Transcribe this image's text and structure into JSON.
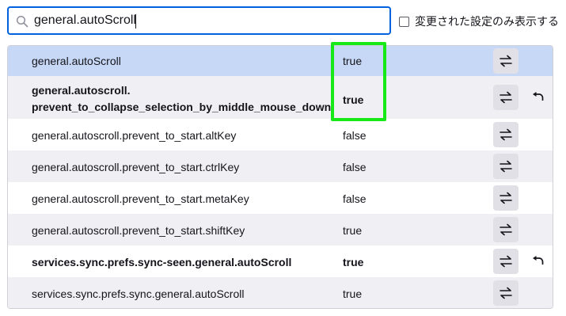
{
  "search": {
    "value": "general.autoScroll",
    "icon": "search-icon"
  },
  "filter": {
    "label": "変更された設定のみ表示する",
    "checked": false
  },
  "prefs": [
    {
      "name": "general.autoScroll",
      "value": "true",
      "modified": false,
      "selected": true
    },
    {
      "name_line1": "general.autoscroll.",
      "name_line2": "prevent_to_collapse_selection_by_middle_mouse_down",
      "value": "true",
      "modified": true,
      "multiline": true
    },
    {
      "name": "general.autoscroll.prevent_to_start.altKey",
      "value": "false",
      "modified": false
    },
    {
      "name": "general.autoscroll.prevent_to_start.ctrlKey",
      "value": "false",
      "modified": false
    },
    {
      "name": "general.autoscroll.prevent_to_start.metaKey",
      "value": "false",
      "modified": false
    },
    {
      "name": "general.autoscroll.prevent_to_start.shiftKey",
      "value": "true",
      "modified": false
    },
    {
      "name": "services.sync.prefs.sync-seen.general.autoScroll",
      "value": "true",
      "modified": true
    },
    {
      "name": "services.sync.prefs.sync.general.autoScroll",
      "value": "true",
      "modified": false
    }
  ],
  "colors": {
    "selected_row": "#c6d8f5",
    "alt_row": "#f0f0f4",
    "highlight": "#17e817",
    "focus": "#0061e0"
  }
}
